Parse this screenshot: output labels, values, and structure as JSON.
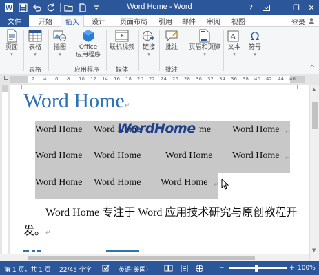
{
  "window": {
    "title": "Word Home - Word",
    "minimize": "−",
    "restore": "❐",
    "close": "✕",
    "help": "?"
  },
  "tabs": {
    "file": "文件",
    "items": [
      "开始",
      "插入",
      "设计",
      "页面布局",
      "引用",
      "邮件",
      "审阅",
      "视图"
    ],
    "active": "插入",
    "signin": "登录"
  },
  "ribbon": {
    "groups": [
      {
        "label": "",
        "buttons": [
          {
            "label": "页面",
            "icon": "page-icon",
            "caret": true
          }
        ]
      },
      {
        "label": "表格",
        "buttons": [
          {
            "label": "表格",
            "icon": "table-icon",
            "caret": true
          }
        ]
      },
      {
        "label": "",
        "buttons": [
          {
            "label": "插图",
            "icon": "illustrations-icon",
            "caret": true
          }
        ]
      },
      {
        "label": "应用程序",
        "buttons": [
          {
            "label": "Office\n应用程序",
            "icon": "office-apps-icon",
            "caret": true
          }
        ]
      },
      {
        "label": "媒体",
        "buttons": [
          {
            "label": "联机视频",
            "icon": "online-video-icon"
          }
        ]
      },
      {
        "label": "",
        "buttons": [
          {
            "label": "链接",
            "icon": "link-icon",
            "caret": true
          }
        ]
      },
      {
        "label": "批注",
        "buttons": [
          {
            "label": "批注",
            "icon": "comment-icon"
          }
        ]
      },
      {
        "label": "",
        "buttons": [
          {
            "label": "页眉和页脚",
            "icon": "header-footer-icon",
            "caret": true
          }
        ]
      },
      {
        "label": "",
        "buttons": [
          {
            "label": "文本",
            "icon": "text-icon",
            "caret": true
          }
        ]
      },
      {
        "label": "",
        "buttons": [
          {
            "label": "符号",
            "icon": "symbol-icon",
            "caret": true
          }
        ]
      }
    ],
    "collapse": "^"
  },
  "ruler": {
    "numbers": [
      "2",
      "4",
      "6",
      "8",
      "10",
      "12",
      "14",
      "16",
      "18",
      "20",
      "22",
      "24",
      "26",
      "28",
      "30",
      "32",
      "34",
      "36",
      "38",
      "40",
      "42",
      "44",
      "46"
    ]
  },
  "document": {
    "heading": "Word Home",
    "wordart": "WordHome",
    "grid_rows": [
      [
        "Word Home",
        "Word Home",
        "",
        "Word Home"
      ],
      [
        "Word Home",
        "Word Home",
        "Word Home",
        "Word Home"
      ],
      [
        "Word Home",
        "Word Home",
        "Word Home"
      ]
    ],
    "grid_row1_third": "me",
    "paragraph": "Word Home 专注于 Word 应用技术研究与原创教程开发。",
    "para_mark": "↵"
  },
  "statusbar": {
    "page": "第 1 页，共 1 页",
    "words": "22/45 个字",
    "language": "英语(美国)",
    "zoom": "100%",
    "zoom_out": "−",
    "zoom_in": "+"
  },
  "colors": {
    "accent": "#2b579a",
    "heading": "#2e74b5",
    "highlight": "#c8c8c8"
  }
}
